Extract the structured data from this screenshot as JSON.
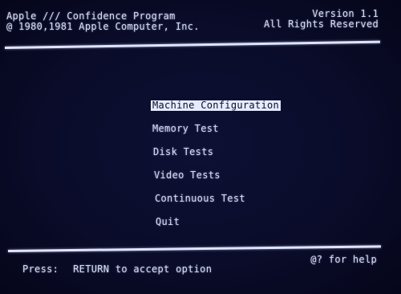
{
  "header": {
    "program_title": "Apple /// Confidence Program",
    "copyright": "@ 1980,1981 Apple Computer, Inc.",
    "version": "Version 1.1",
    "rights": "All Rights Reserved"
  },
  "menu": {
    "selected_index": 0,
    "items": [
      {
        "label": "Machine Configuration"
      },
      {
        "label": "Memory Test"
      },
      {
        "label": "Disk Tests"
      },
      {
        "label": "Video Tests"
      },
      {
        "label": "Continuous Test"
      },
      {
        "label": "Quit"
      }
    ]
  },
  "footer": {
    "press_label": "Press:",
    "return_hint": "RETURN to accept option",
    "help_hint": "@? for help"
  },
  "colors": {
    "background": "#0a0c2a",
    "foreground": "#d6dcf4",
    "highlight": "#e6ebff"
  }
}
